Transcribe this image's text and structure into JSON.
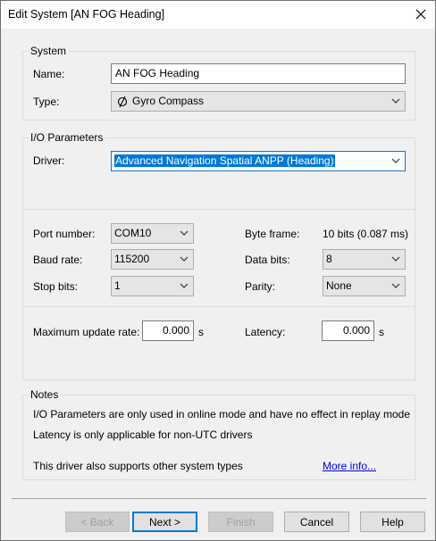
{
  "window": {
    "title": "Edit System [AN FOG Heading]"
  },
  "system": {
    "group_label": "System",
    "name_label": "Name:",
    "name_value": "AN FOG Heading",
    "type_label": "Type:",
    "type_value": "Gyro Compass",
    "type_icon": "gyro-compass-icon"
  },
  "io": {
    "group_label": "I/O Parameters",
    "driver_label": "Driver:",
    "driver_value": "Advanced Navigation Spatial ANPP (Heading)",
    "port_label": "Port number:",
    "port_value": "COM10",
    "baud_label": "Baud rate:",
    "baud_value": "115200",
    "stop_label": "Stop bits:",
    "stop_value": "1",
    "byteframe_label": "Byte frame:",
    "byteframe_value": "10 bits (0.087 ms)",
    "databits_label": "Data bits:",
    "databits_value": "8",
    "parity_label": "Parity:",
    "parity_value": "None",
    "maxrate_label": "Maximum update rate:",
    "maxrate_value": "0.000",
    "maxrate_unit": "s",
    "latency_label": "Latency:",
    "latency_value": "0.000",
    "latency_unit": "s"
  },
  "notes": {
    "group_label": "Notes",
    "line1": "I/O Parameters are only used in online mode and have no effect in replay mode",
    "line2": "Latency is only applicable for non-UTC drivers",
    "line3": "This driver also supports other system types",
    "more_link": "More info..."
  },
  "buttons": {
    "back": "< Back",
    "next": "Next >",
    "finish": "Finish",
    "cancel": "Cancel",
    "help": "Help"
  }
}
